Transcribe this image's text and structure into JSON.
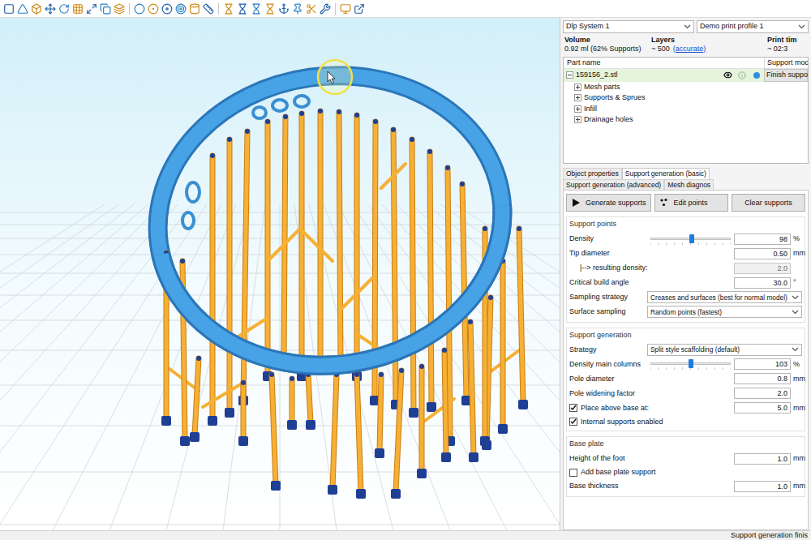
{
  "printer": "Dlp System 1",
  "profile": "Demo print profile 1",
  "stats": [
    {
      "label": "Volume",
      "value": "0.92 ml (62% Supports)",
      "link": ""
    },
    {
      "label": "Layers",
      "value": "~ 500",
      "link": "(accurate)"
    },
    {
      "label": "Print tim",
      "value": "~ 02:3",
      "link": ""
    }
  ],
  "tree": {
    "columns": [
      "Part name",
      "Support mod"
    ],
    "part": {
      "name": "159156_2.stl",
      "expanded": true,
      "selected": true,
      "visible": true,
      "color": "#2f8fe0",
      "support_mode": "Finish suppo"
    },
    "children": [
      {
        "label": "Mesh parts",
        "expanded": false
      },
      {
        "label": "Supports & Sprues",
        "expanded": false
      },
      {
        "label": "Infill",
        "expanded": false
      },
      {
        "label": "Drainage holes",
        "expanded": false
      }
    ]
  },
  "tabs": [
    {
      "label": "Object properties",
      "selected": false
    },
    {
      "label": "Support generation (basic)",
      "selected": true
    },
    {
      "label": "Support generation (advanced)",
      "selected": false
    },
    {
      "label": "Mesh diagnos",
      "selected": false
    }
  ],
  "actions": [
    {
      "label": "Generate supports",
      "kind": "play"
    },
    {
      "label": "Edit points",
      "kind": "dots"
    },
    {
      "label": "Clear supports",
      "kind": "plain"
    }
  ],
  "groups": [
    {
      "title": "Support points",
      "rows": [
        {
          "kind": "slider",
          "label": "Density",
          "level": 0.52,
          "value": "98",
          "unit": "%"
        },
        {
          "kind": "number",
          "label": "Tip diameter",
          "value": "0.50",
          "unit": "mm",
          "disabled": false
        },
        {
          "kind": "number",
          "label": "|--> resulting density:",
          "value": "2.0",
          "unit": "",
          "disabled": true
        },
        {
          "kind": "number",
          "label": "Critical build angle",
          "value": "30.0",
          "unit": "°",
          "disabled": false
        },
        {
          "kind": "select",
          "label": "Sampling strategy",
          "value": "Creases and surfaces (best for normal model)"
        },
        {
          "kind": "select",
          "label": "Surface sampling",
          "value": "Random points (fastest)"
        }
      ]
    },
    {
      "title": "Support generation",
      "rows": [
        {
          "kind": "select",
          "label": "Strategy",
          "value": "Split style scaffolding (default)"
        },
        {
          "kind": "slider",
          "label": "Density main columns",
          "level": 0.51,
          "value": "103",
          "unit": "%"
        },
        {
          "kind": "number",
          "label": "Pole diameter",
          "value": "0.8",
          "unit": "mm",
          "disabled": false
        },
        {
          "kind": "number",
          "label": "Pole widening factor",
          "value": "2.0",
          "unit": "",
          "disabled": false
        },
        {
          "kind": "checknumber",
          "label": "Place above base at:",
          "checked": true,
          "value": "5.0",
          "unit": "mm"
        },
        {
          "kind": "checkbox",
          "label": "Internal supports enabled",
          "checked": true
        }
      ]
    },
    {
      "title": "Base plate",
      "rows": [
        {
          "kind": "number",
          "label": "Height of the foot",
          "value": "1.0",
          "unit": "mm",
          "disabled": false
        },
        {
          "kind": "checkbox",
          "label": "Add base plate support",
          "checked": false
        },
        {
          "kind": "number",
          "label": "Base thickness",
          "value": "1.0",
          "unit": "mm",
          "disabled": false
        }
      ]
    }
  ],
  "status_bar": "Support generation finis"
}
